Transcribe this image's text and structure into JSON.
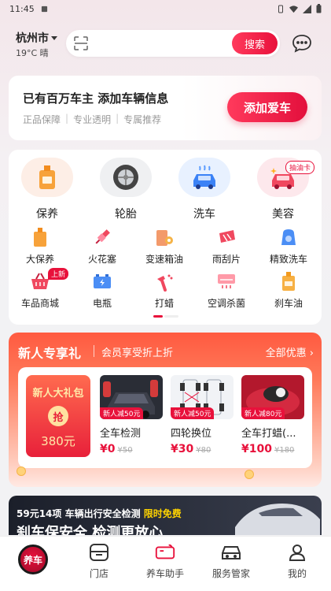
{
  "status_bar": {
    "time": "11:45"
  },
  "header": {
    "city": "杭州市",
    "weather": "19°C 晴",
    "search_button": "搜索"
  },
  "add_car": {
    "title": "已有百万车主 添加车辆信息",
    "features": [
      "正品保障",
      "专业透明",
      "专属推荐"
    ],
    "button": "添加爱车"
  },
  "main_services": [
    {
      "label": "保养",
      "icon": "oil-bottle-icon"
    },
    {
      "label": "轮胎",
      "icon": "tire-icon"
    },
    {
      "label": "洗车",
      "icon": "car-wash-icon"
    },
    {
      "label": "美容",
      "icon": "car-beauty-icon"
    }
  ],
  "beauty_tag": "抽油卡",
  "sub_services": [
    {
      "label": "大保养",
      "icon": "oil-can-icon"
    },
    {
      "label": "火花塞",
      "icon": "spark-plug-icon"
    },
    {
      "label": "变速箱油",
      "icon": "gearbox-oil-icon"
    },
    {
      "label": "雨刮片",
      "icon": "wiper-icon"
    },
    {
      "label": "精致洗车",
      "icon": "fine-wash-icon"
    },
    {
      "label": "车品商城",
      "icon": "shopping-basket-icon",
      "badge": "上新"
    },
    {
      "label": "电瓶",
      "icon": "battery-icon"
    },
    {
      "label": "打蜡",
      "icon": "wax-spray-icon"
    },
    {
      "label": "空调杀菌",
      "icon": "air-conditioner-icon"
    },
    {
      "label": "刹车油",
      "icon": "brake-oil-icon"
    }
  ],
  "promo": {
    "title": "新人专享礼",
    "subtitle": "会员享受折上折",
    "all_link": "全部优惠 ›",
    "gift": {
      "title": "新人大礼包",
      "grab": "抢",
      "price": "380元"
    },
    "deals": [
      {
        "name": "全车检测",
        "now": "¥0",
        "was": "¥50",
        "badge": "新人减50元"
      },
      {
        "name": "四轮换位",
        "now": "¥30",
        "was": "¥80",
        "badge": "新人减50元"
      },
      {
        "name": "全车打蜡(...",
        "now": "¥100",
        "was": "¥180",
        "badge": "新人减80元"
      }
    ]
  },
  "banner": {
    "line1_prefix": "59元14项 车辆出行安全检测 ",
    "line1_highlight": "限时免费",
    "line2": "刹车保安全 检测更放心"
  },
  "tabbar": {
    "home_label": "养车",
    "tabs": [
      {
        "label": "门店",
        "icon": "store-icon"
      },
      {
        "label": "养车助手",
        "icon": "assistant-icon"
      },
      {
        "label": "服务管家",
        "icon": "car-butler-icon"
      },
      {
        "label": "我的",
        "icon": "profile-icon"
      }
    ]
  }
}
